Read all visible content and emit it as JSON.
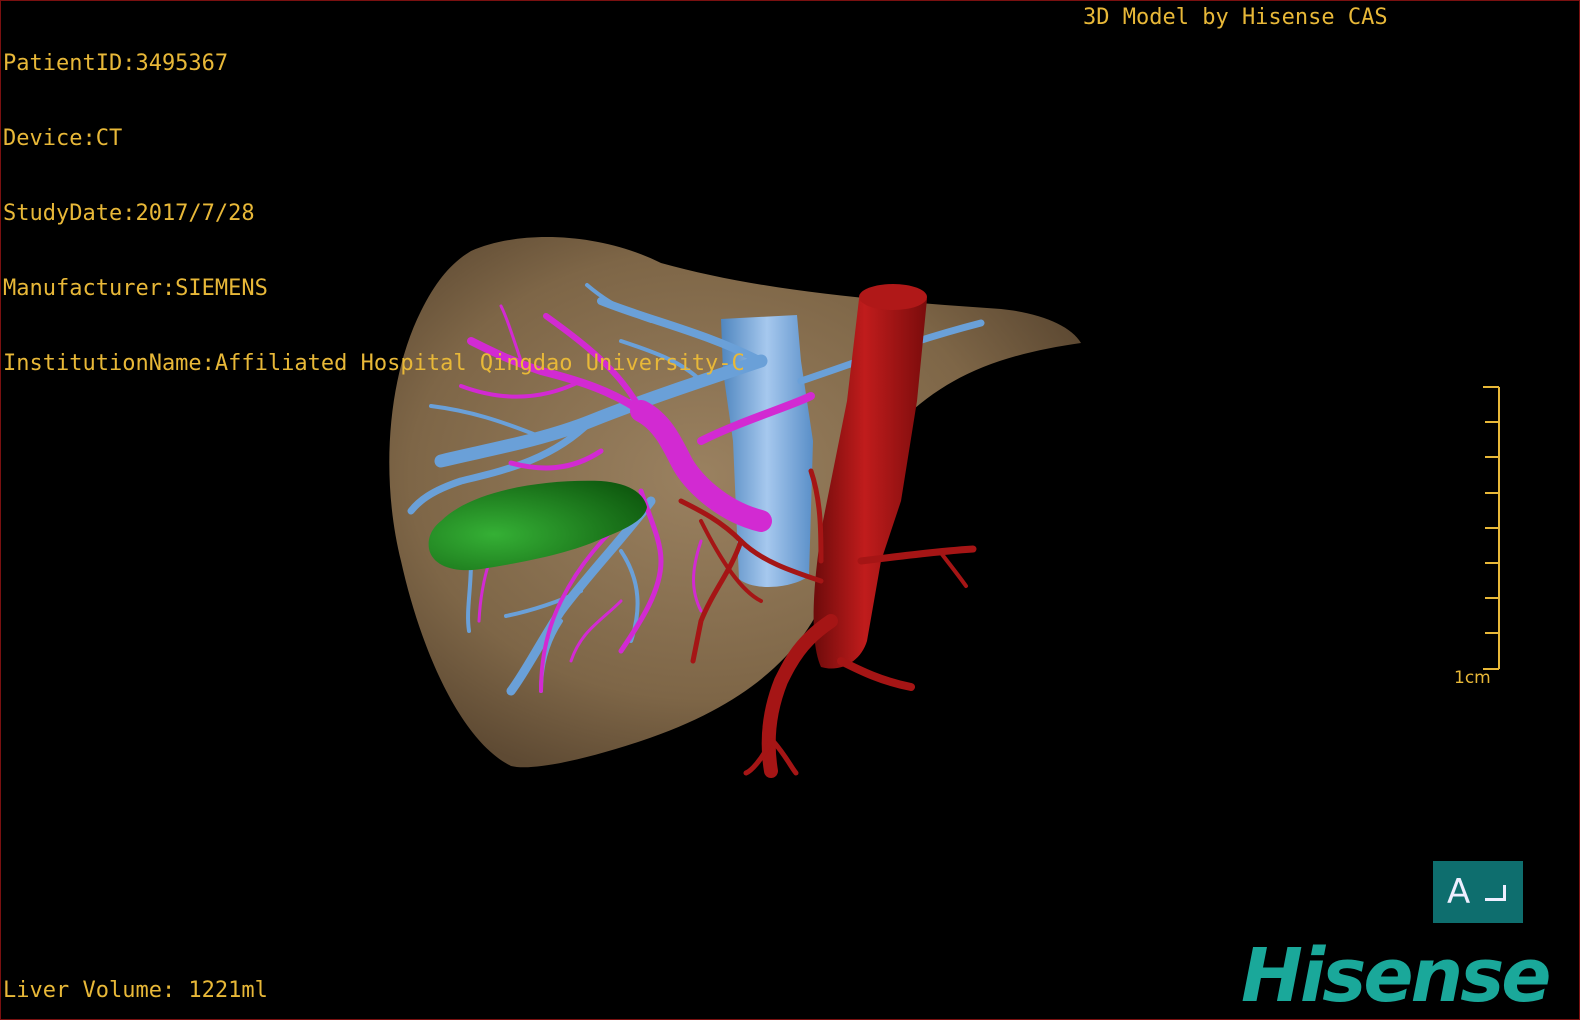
{
  "overlay": {
    "patient_id": "PatientID:3495367",
    "device": "Device:CT",
    "study_date": "StudyDate:2017/7/28",
    "manufacturer": "Manufacturer:SIEMENS",
    "institution": "InstitutionName:Affiliated Hospital Qingdao University-C",
    "credit": "3D Model by Hisense CAS",
    "liver_volume": "Liver Volume: 1221ml"
  },
  "scale_bar": {
    "label": "1cm"
  },
  "orientation": {
    "letter": "A"
  },
  "logo": {
    "text": "Hisense"
  },
  "colors": {
    "text": "#e8b838",
    "liver": "#8b7352",
    "portal_vein": "#d22ad2",
    "hepatic_vein": "#6aa0d8",
    "ivc": "#7aaee0",
    "aorta": "#a51515",
    "gallbladder": "#1f8a1f",
    "logo": "#1aa89a",
    "orientation_bg": "#0e6e6e"
  }
}
